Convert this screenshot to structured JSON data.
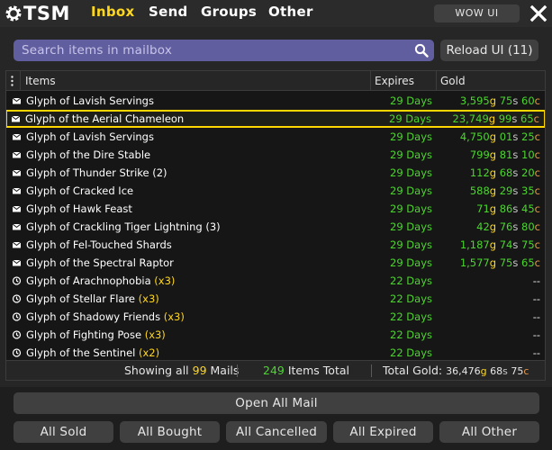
{
  "nav": {
    "logo": "TSM",
    "tabs": [
      {
        "label": "Inbox",
        "active": true
      },
      {
        "label": "Send",
        "active": false
      },
      {
        "label": "Groups",
        "active": false
      },
      {
        "label": "Other",
        "active": false
      }
    ],
    "wow_ui_label": "WOW UI",
    "close_icon": "close-icon"
  },
  "search": {
    "placeholder": "Search items in mailbox",
    "icon": "search-icon",
    "reload_label": "Reload UI (11)"
  },
  "table": {
    "headers": {
      "items": "Items",
      "expires": "Expires",
      "gold": "Gold"
    },
    "rows": [
      {
        "icon": "mail-icon",
        "name": "Glyph of Lavish Servings",
        "qty": "",
        "expires": "29 Days",
        "gold": "3,595",
        "silver": "75",
        "copper": "60",
        "highlight": false
      },
      {
        "icon": "mail-icon",
        "name": "Glyph of the Aerial Chameleon",
        "qty": "",
        "expires": "29 Days",
        "gold": "23,749",
        "silver": "99",
        "copper": "65",
        "highlight": true
      },
      {
        "icon": "mail-icon",
        "name": "Glyph of Lavish Servings",
        "qty": "",
        "expires": "29 Days",
        "gold": "4,750",
        "silver": "01",
        "copper": "25",
        "highlight": false
      },
      {
        "icon": "mail-icon",
        "name": "Glyph of the Dire Stable",
        "qty": "",
        "expires": "29 Days",
        "gold": "799",
        "silver": "81",
        "copper": "10",
        "highlight": false
      },
      {
        "icon": "mail-icon",
        "name": "Glyph of Thunder Strike (2)",
        "qty": "",
        "expires": "29 Days",
        "gold": "112",
        "silver": "68",
        "copper": "20",
        "highlight": false
      },
      {
        "icon": "mail-icon",
        "name": "Glyph of Cracked Ice",
        "qty": "",
        "expires": "29 Days",
        "gold": "588",
        "silver": "29",
        "copper": "35",
        "highlight": false
      },
      {
        "icon": "mail-icon",
        "name": "Glyph of Hawk Feast",
        "qty": "",
        "expires": "29 Days",
        "gold": "71",
        "silver": "86",
        "copper": "45",
        "highlight": false
      },
      {
        "icon": "mail-icon",
        "name": "Glyph of Crackling Tiger Lightning (3)",
        "qty": "",
        "expires": "29 Days",
        "gold": "42",
        "silver": "76",
        "copper": "80",
        "highlight": false
      },
      {
        "icon": "mail-icon",
        "name": "Glyph of Fel-Touched Shards",
        "qty": "",
        "expires": "29 Days",
        "gold": "1,187",
        "silver": "74",
        "copper": "75",
        "highlight": false
      },
      {
        "icon": "mail-icon",
        "name": "Glyph of the Spectral Raptor",
        "qty": "",
        "expires": "29 Days",
        "gold": "1,577",
        "silver": "75",
        "copper": "65",
        "highlight": false
      },
      {
        "icon": "clock-icon",
        "name": "Glyph of Arachnophobia",
        "qty": "(x3)",
        "expires": "22 Days",
        "gold": "",
        "silver": "",
        "copper": "",
        "dash": "--",
        "highlight": false
      },
      {
        "icon": "clock-icon",
        "name": "Glyph of Stellar Flare",
        "qty": "(x3)",
        "expires": "22 Days",
        "gold": "",
        "silver": "",
        "copper": "",
        "dash": "--",
        "highlight": false
      },
      {
        "icon": "clock-icon",
        "name": "Glyph of Shadowy Friends",
        "qty": "(x3)",
        "expires": "22 Days",
        "gold": "",
        "silver": "",
        "copper": "",
        "dash": "--",
        "highlight": false
      },
      {
        "icon": "clock-icon",
        "name": "Glyph of Fighting Pose",
        "qty": "(x3)",
        "expires": "22 Days",
        "gold": "",
        "silver": "",
        "copper": "",
        "dash": "--",
        "highlight": false
      },
      {
        "icon": "clock-icon",
        "name": "Glyph of the Sentinel",
        "qty": "(x2)",
        "expires": "22 Days",
        "gold": "",
        "silver": "",
        "copper": "",
        "dash": "--",
        "highlight": false
      }
    ],
    "footer": {
      "showing_prefix": "Showing all",
      "showing_count": "99",
      "showing_suffix": "Mails",
      "items_count": "249",
      "items_suffix": "Items Total",
      "total_label": "Total Gold:",
      "total_gold": "36,476",
      "total_silver": "68",
      "total_copper": "75"
    }
  },
  "units": {
    "g": "g",
    "s": "s",
    "c": "c"
  },
  "buttons": {
    "open_all": "Open All Mail",
    "filters": [
      "All Sold",
      "All Bought",
      "All Cancelled",
      "All Expired",
      "All Other"
    ]
  },
  "colors": {
    "accent": "#ffd71e",
    "green": "#4bd62e",
    "search_bg": "#615ea0",
    "highlight": "#ffd700"
  }
}
